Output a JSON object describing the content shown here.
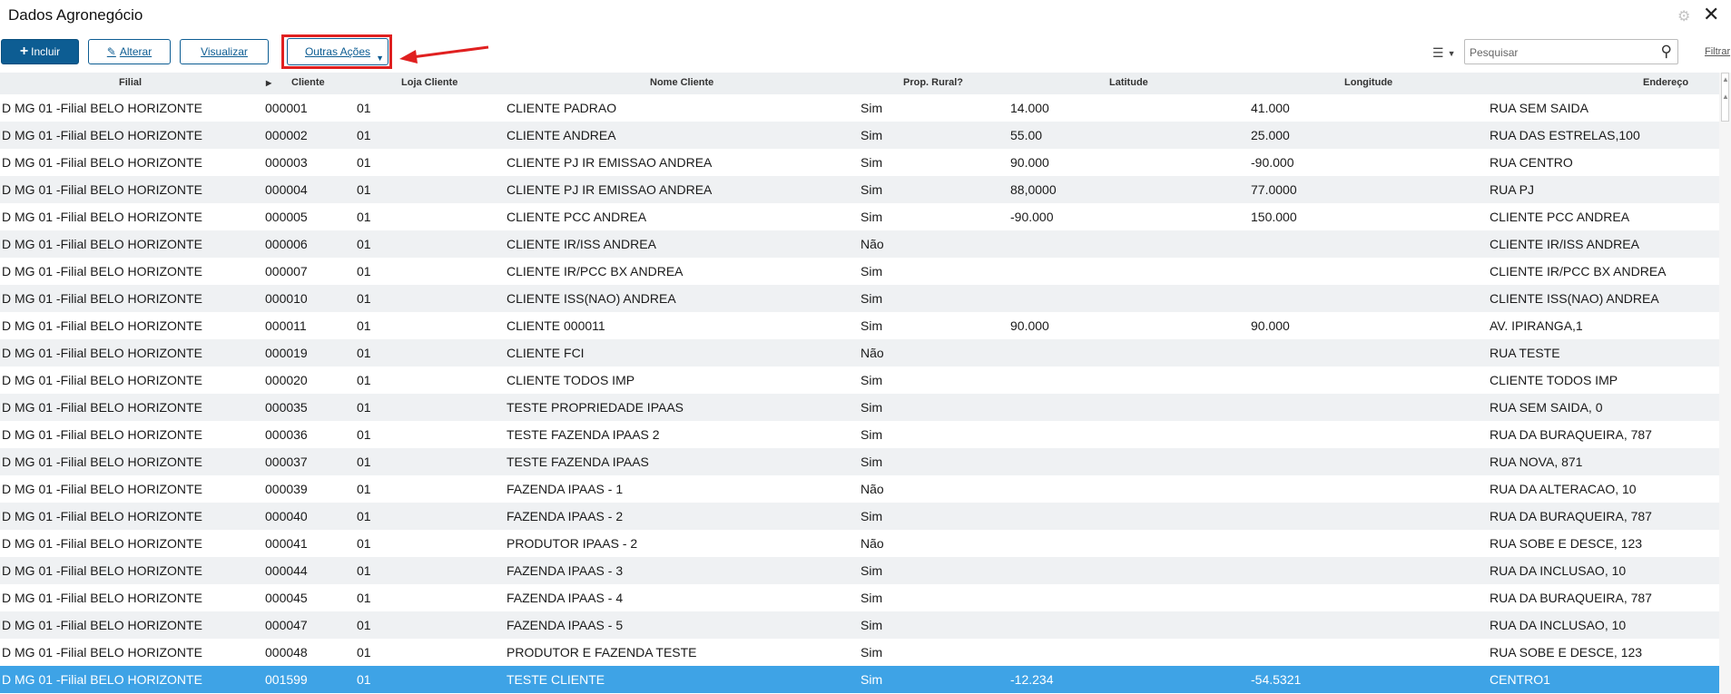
{
  "window": {
    "title": "Dados Agronegócio"
  },
  "toolbar": {
    "incluir": "Incluir",
    "alterar": "Alterar",
    "visualizar": "Visualizar",
    "outras_acoes": "Outras Ações"
  },
  "search": {
    "placeholder": "Pesquisar",
    "filter_label": "Filtrar"
  },
  "accent": {
    "primary": "#0d5d93",
    "selected_row": "#3ea3e6",
    "highlight": "#e02020"
  },
  "table": {
    "headers": {
      "filial": "Filial",
      "cliente": "Cliente",
      "loja": "Loja Cliente",
      "nome": "Nome Cliente",
      "prop": "Prop. Rural?",
      "lat": "Latitude",
      "long": "Longitude",
      "end": "Endereço"
    },
    "rows": [
      {
        "filial": "D MG 01 -Filial BELO HORIZONTE",
        "cliente": "000001",
        "loja": "01",
        "nome": "CLIENTE PADRAO",
        "prop": "Sim",
        "lat": "14.000",
        "long": "41.000",
        "end": "RUA SEM SAIDA"
      },
      {
        "filial": "D MG 01 -Filial BELO HORIZONTE",
        "cliente": "000002",
        "loja": "01",
        "nome": "CLIENTE ANDREA",
        "prop": "Sim",
        "lat": "55.00",
        "long": "25.000",
        "end": "RUA DAS ESTRELAS,100"
      },
      {
        "filial": "D MG 01 -Filial BELO HORIZONTE",
        "cliente": "000003",
        "loja": "01",
        "nome": "CLIENTE PJ IR EMISSAO ANDREA",
        "prop": "Sim",
        "lat": "90.000",
        "long": "-90.000",
        "end": "RUA CENTRO"
      },
      {
        "filial": "D MG 01 -Filial BELO HORIZONTE",
        "cliente": "000004",
        "loja": "01",
        "nome": "CLIENTE PJ IR EMISSAO ANDREA",
        "prop": "Sim",
        "lat": "88,0000",
        "long": "77.0000",
        "end": "RUA PJ"
      },
      {
        "filial": "D MG 01 -Filial BELO HORIZONTE",
        "cliente": "000005",
        "loja": "01",
        "nome": "CLIENTE PCC ANDREA",
        "prop": "Sim",
        "lat": "-90.000",
        "long": "150.000",
        "end": "CLIENTE PCC ANDREA"
      },
      {
        "filial": "D MG 01 -Filial BELO HORIZONTE",
        "cliente": "000006",
        "loja": "01",
        "nome": "CLIENTE IR/ISS ANDREA",
        "prop": "Não",
        "lat": "",
        "long": "",
        "end": "CLIENTE IR/ISS ANDREA"
      },
      {
        "filial": "D MG 01 -Filial BELO HORIZONTE",
        "cliente": "000007",
        "loja": "01",
        "nome": "CLIENTE IR/PCC BX ANDREA",
        "prop": "Sim",
        "lat": "",
        "long": "",
        "end": "CLIENTE IR/PCC BX ANDREA"
      },
      {
        "filial": "D MG 01 -Filial BELO HORIZONTE",
        "cliente": "000010",
        "loja": "01",
        "nome": "CLIENTE ISS(NAO) ANDREA",
        "prop": "Sim",
        "lat": "",
        "long": "",
        "end": "CLIENTE ISS(NAO) ANDREA"
      },
      {
        "filial": "D MG 01 -Filial BELO HORIZONTE",
        "cliente": "000011",
        "loja": "01",
        "nome": "CLIENTE 000011",
        "prop": "Sim",
        "lat": "90.000",
        "long": "90.000",
        "end": "AV. IPIRANGA,1"
      },
      {
        "filial": "D MG 01 -Filial BELO HORIZONTE",
        "cliente": "000019",
        "loja": "01",
        "nome": "CLIENTE FCI",
        "prop": "Não",
        "lat": "",
        "long": "",
        "end": "RUA TESTE"
      },
      {
        "filial": "D MG 01 -Filial BELO HORIZONTE",
        "cliente": "000020",
        "loja": "01",
        "nome": "CLIENTE TODOS IMP",
        "prop": "Sim",
        "lat": "",
        "long": "",
        "end": "CLIENTE TODOS IMP"
      },
      {
        "filial": "D MG 01 -Filial BELO HORIZONTE",
        "cliente": "000035",
        "loja": "01",
        "nome": "TESTE PROPRIEDADE IPAAS",
        "prop": "Sim",
        "lat": "",
        "long": "",
        "end": "RUA SEM SAIDA, 0"
      },
      {
        "filial": "D MG 01 -Filial BELO HORIZONTE",
        "cliente": "000036",
        "loja": "01",
        "nome": "TESTE FAZENDA IPAAS 2",
        "prop": "Sim",
        "lat": "",
        "long": "",
        "end": "RUA DA BURAQUEIRA, 787"
      },
      {
        "filial": "D MG 01 -Filial BELO HORIZONTE",
        "cliente": "000037",
        "loja": "01",
        "nome": "TESTE FAZENDA IPAAS",
        "prop": "Sim",
        "lat": "",
        "long": "",
        "end": "RUA NOVA, 871"
      },
      {
        "filial": "D MG 01 -Filial BELO HORIZONTE",
        "cliente": "000039",
        "loja": "01",
        "nome": "FAZENDA IPAAS - 1",
        "prop": "Não",
        "lat": "",
        "long": "",
        "end": "RUA DA ALTERACAO, 10"
      },
      {
        "filial": "D MG 01 -Filial BELO HORIZONTE",
        "cliente": "000040",
        "loja": "01",
        "nome": "FAZENDA IPAAS - 2",
        "prop": "Sim",
        "lat": "",
        "long": "",
        "end": "RUA DA BURAQUEIRA, 787"
      },
      {
        "filial": "D MG 01 -Filial BELO HORIZONTE",
        "cliente": "000041",
        "loja": "01",
        "nome": "PRODUTOR IPAAS - 2",
        "prop": "Não",
        "lat": "",
        "long": "",
        "end": "RUA SOBE E DESCE, 123"
      },
      {
        "filial": "D MG 01 -Filial BELO HORIZONTE",
        "cliente": "000044",
        "loja": "01",
        "nome": "FAZENDA IPAAS - 3",
        "prop": "Sim",
        "lat": "",
        "long": "",
        "end": "RUA DA INCLUSAO, 10"
      },
      {
        "filial": "D MG 01 -Filial BELO HORIZONTE",
        "cliente": "000045",
        "loja": "01",
        "nome": "FAZENDA IPAAS - 4",
        "prop": "Sim",
        "lat": "",
        "long": "",
        "end": "RUA DA BURAQUEIRA, 787"
      },
      {
        "filial": "D MG 01 -Filial BELO HORIZONTE",
        "cliente": "000047",
        "loja": "01",
        "nome": "FAZENDA IPAAS - 5",
        "prop": "Sim",
        "lat": "",
        "long": "",
        "end": "RUA DA INCLUSAO, 10"
      },
      {
        "filial": "D MG 01 -Filial BELO HORIZONTE",
        "cliente": "000048",
        "loja": "01",
        "nome": "PRODUTOR E FAZENDA TESTE",
        "prop": "Sim",
        "lat": "",
        "long": "",
        "end": "RUA SOBE E DESCE, 123"
      },
      {
        "filial": "D MG 01 -Filial BELO HORIZONTE",
        "cliente": "001599",
        "loja": "01",
        "nome": "TESTE CLIENTE",
        "prop": "Sim",
        "lat": "-12.234",
        "long": "-54.5321",
        "end": "CENTRO1",
        "selected": true
      }
    ]
  }
}
